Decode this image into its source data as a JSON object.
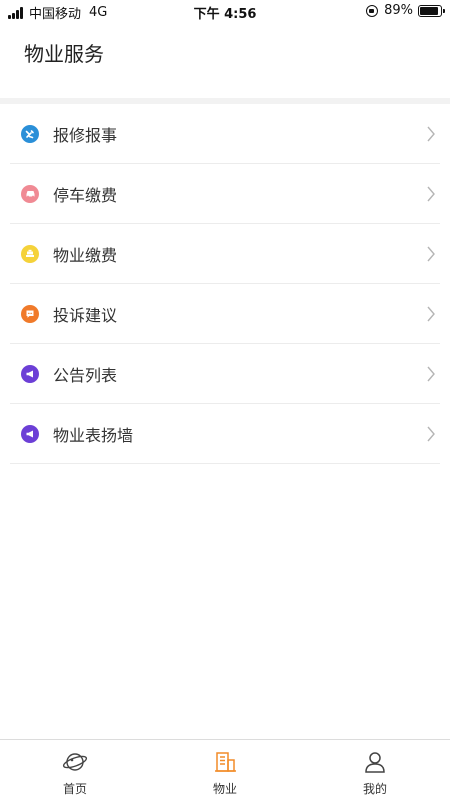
{
  "status_bar": {
    "carrier": "中国移动",
    "network": "4G",
    "time": "下午 4:56",
    "battery_percent": "89%",
    "battery_level": 0.89
  },
  "header": {
    "title": "物业服务"
  },
  "menu": {
    "items": [
      {
        "label": "报修报事",
        "icon": "tools-icon",
        "color": "#2a8fd8"
      },
      {
        "label": "停车缴费",
        "icon": "car-icon",
        "color": "#f08a94"
      },
      {
        "label": "物业缴费",
        "icon": "payment-icon",
        "color": "#f5d23a"
      },
      {
        "label": "投诉建议",
        "icon": "chat-icon",
        "color": "#f07a2a"
      },
      {
        "label": "公告列表",
        "icon": "megaphone-icon",
        "color": "#6c3fd6"
      },
      {
        "label": "物业表扬墙",
        "icon": "megaphone-icon",
        "color": "#6c3fd6"
      }
    ]
  },
  "tab_bar": {
    "tabs": [
      {
        "label": "首页",
        "icon": "planet-icon",
        "active": false
      },
      {
        "label": "物业",
        "icon": "building-icon",
        "active": true,
        "color": "#f28c28"
      },
      {
        "label": "我的",
        "icon": "user-icon",
        "active": false
      }
    ]
  }
}
